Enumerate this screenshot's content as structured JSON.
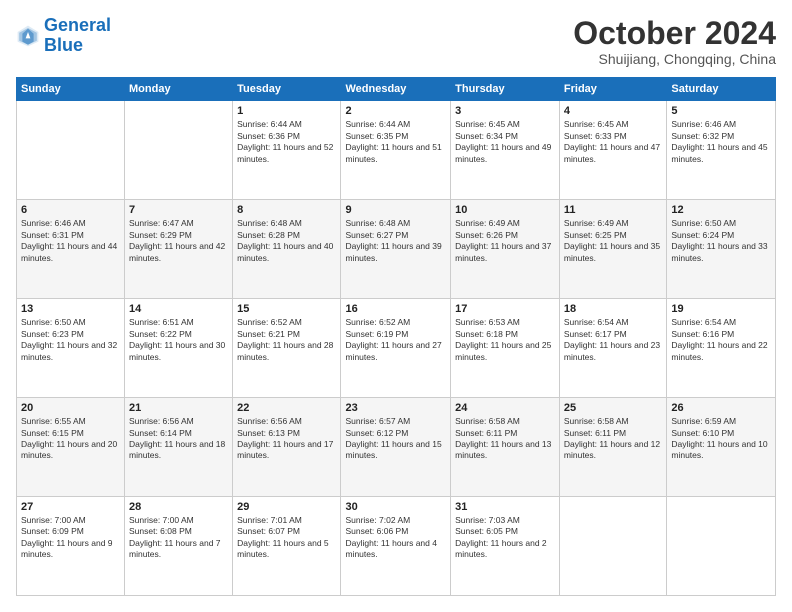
{
  "logo": {
    "line1": "General",
    "line2": "Blue"
  },
  "header": {
    "month": "October 2024",
    "location": "Shuijiang, Chongqing, China"
  },
  "days_of_week": [
    "Sunday",
    "Monday",
    "Tuesday",
    "Wednesday",
    "Thursday",
    "Friday",
    "Saturday"
  ],
  "weeks": [
    [
      {
        "day": "",
        "content": ""
      },
      {
        "day": "",
        "content": ""
      },
      {
        "day": "1",
        "content": "Sunrise: 6:44 AM\nSunset: 6:36 PM\nDaylight: 11 hours and 52 minutes."
      },
      {
        "day": "2",
        "content": "Sunrise: 6:44 AM\nSunset: 6:35 PM\nDaylight: 11 hours and 51 minutes."
      },
      {
        "day": "3",
        "content": "Sunrise: 6:45 AM\nSunset: 6:34 PM\nDaylight: 11 hours and 49 minutes."
      },
      {
        "day": "4",
        "content": "Sunrise: 6:45 AM\nSunset: 6:33 PM\nDaylight: 11 hours and 47 minutes."
      },
      {
        "day": "5",
        "content": "Sunrise: 6:46 AM\nSunset: 6:32 PM\nDaylight: 11 hours and 45 minutes."
      }
    ],
    [
      {
        "day": "6",
        "content": "Sunrise: 6:46 AM\nSunset: 6:31 PM\nDaylight: 11 hours and 44 minutes."
      },
      {
        "day": "7",
        "content": "Sunrise: 6:47 AM\nSunset: 6:29 PM\nDaylight: 11 hours and 42 minutes."
      },
      {
        "day": "8",
        "content": "Sunrise: 6:48 AM\nSunset: 6:28 PM\nDaylight: 11 hours and 40 minutes."
      },
      {
        "day": "9",
        "content": "Sunrise: 6:48 AM\nSunset: 6:27 PM\nDaylight: 11 hours and 39 minutes."
      },
      {
        "day": "10",
        "content": "Sunrise: 6:49 AM\nSunset: 6:26 PM\nDaylight: 11 hours and 37 minutes."
      },
      {
        "day": "11",
        "content": "Sunrise: 6:49 AM\nSunset: 6:25 PM\nDaylight: 11 hours and 35 minutes."
      },
      {
        "day": "12",
        "content": "Sunrise: 6:50 AM\nSunset: 6:24 PM\nDaylight: 11 hours and 33 minutes."
      }
    ],
    [
      {
        "day": "13",
        "content": "Sunrise: 6:50 AM\nSunset: 6:23 PM\nDaylight: 11 hours and 32 minutes."
      },
      {
        "day": "14",
        "content": "Sunrise: 6:51 AM\nSunset: 6:22 PM\nDaylight: 11 hours and 30 minutes."
      },
      {
        "day": "15",
        "content": "Sunrise: 6:52 AM\nSunset: 6:21 PM\nDaylight: 11 hours and 28 minutes."
      },
      {
        "day": "16",
        "content": "Sunrise: 6:52 AM\nSunset: 6:19 PM\nDaylight: 11 hours and 27 minutes."
      },
      {
        "day": "17",
        "content": "Sunrise: 6:53 AM\nSunset: 6:18 PM\nDaylight: 11 hours and 25 minutes."
      },
      {
        "day": "18",
        "content": "Sunrise: 6:54 AM\nSunset: 6:17 PM\nDaylight: 11 hours and 23 minutes."
      },
      {
        "day": "19",
        "content": "Sunrise: 6:54 AM\nSunset: 6:16 PM\nDaylight: 11 hours and 22 minutes."
      }
    ],
    [
      {
        "day": "20",
        "content": "Sunrise: 6:55 AM\nSunset: 6:15 PM\nDaylight: 11 hours and 20 minutes."
      },
      {
        "day": "21",
        "content": "Sunrise: 6:56 AM\nSunset: 6:14 PM\nDaylight: 11 hours and 18 minutes."
      },
      {
        "day": "22",
        "content": "Sunrise: 6:56 AM\nSunset: 6:13 PM\nDaylight: 11 hours and 17 minutes."
      },
      {
        "day": "23",
        "content": "Sunrise: 6:57 AM\nSunset: 6:12 PM\nDaylight: 11 hours and 15 minutes."
      },
      {
        "day": "24",
        "content": "Sunrise: 6:58 AM\nSunset: 6:11 PM\nDaylight: 11 hours and 13 minutes."
      },
      {
        "day": "25",
        "content": "Sunrise: 6:58 AM\nSunset: 6:11 PM\nDaylight: 11 hours and 12 minutes."
      },
      {
        "day": "26",
        "content": "Sunrise: 6:59 AM\nSunset: 6:10 PM\nDaylight: 11 hours and 10 minutes."
      }
    ],
    [
      {
        "day": "27",
        "content": "Sunrise: 7:00 AM\nSunset: 6:09 PM\nDaylight: 11 hours and 9 minutes."
      },
      {
        "day": "28",
        "content": "Sunrise: 7:00 AM\nSunset: 6:08 PM\nDaylight: 11 hours and 7 minutes."
      },
      {
        "day": "29",
        "content": "Sunrise: 7:01 AM\nSunset: 6:07 PM\nDaylight: 11 hours and 5 minutes."
      },
      {
        "day": "30",
        "content": "Sunrise: 7:02 AM\nSunset: 6:06 PM\nDaylight: 11 hours and 4 minutes."
      },
      {
        "day": "31",
        "content": "Sunrise: 7:03 AM\nSunset: 6:05 PM\nDaylight: 11 hours and 2 minutes."
      },
      {
        "day": "",
        "content": ""
      },
      {
        "day": "",
        "content": ""
      }
    ]
  ]
}
